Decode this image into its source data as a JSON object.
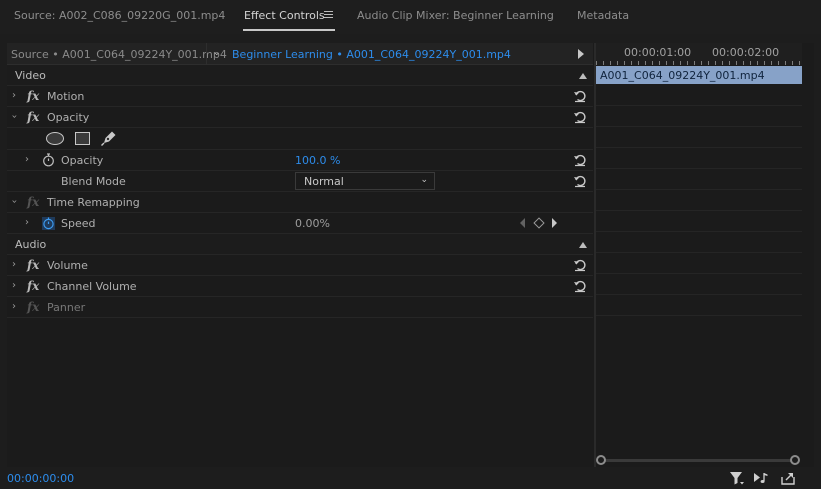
{
  "tabs": [
    {
      "label": "Source: A002_C086_09220G_001.mp4",
      "active": false
    },
    {
      "label": "Effect Controls",
      "active": true
    },
    {
      "label": "Audio Clip Mixer: Beginner Learning",
      "active": false
    },
    {
      "label": "Metadata",
      "active": false
    }
  ],
  "clip_header": {
    "source": "Source • A001_C064_09224Y_001.mp4",
    "sequence": "Beginner Learning • A001_C064_09224Y_001.mp4"
  },
  "sections": {
    "video": "Video",
    "audio": "Audio"
  },
  "effects": {
    "motion": "Motion",
    "opacity": "Opacity",
    "opacity_param": {
      "label": "Opacity",
      "value": "100.0 %"
    },
    "blend_mode": {
      "label": "Blend Mode",
      "value": "Normal"
    },
    "time_remapping": "Time Remapping",
    "speed": {
      "label": "Speed",
      "value": "0.00%"
    },
    "volume": "Volume",
    "channel_volume": "Channel Volume",
    "panner": "Panner"
  },
  "fx_glyph": "fx",
  "timeline": {
    "ruler": [
      "00:00:01:00",
      "00:00:02:00"
    ],
    "clip_name": "A001_C064_09224Y_001.mp4"
  },
  "timecode": "00:00:00:00",
  "colors": {
    "accent_blue": "#2d8ceb",
    "clip_bar": "#87a2c8",
    "background": "#1d1d1d"
  }
}
